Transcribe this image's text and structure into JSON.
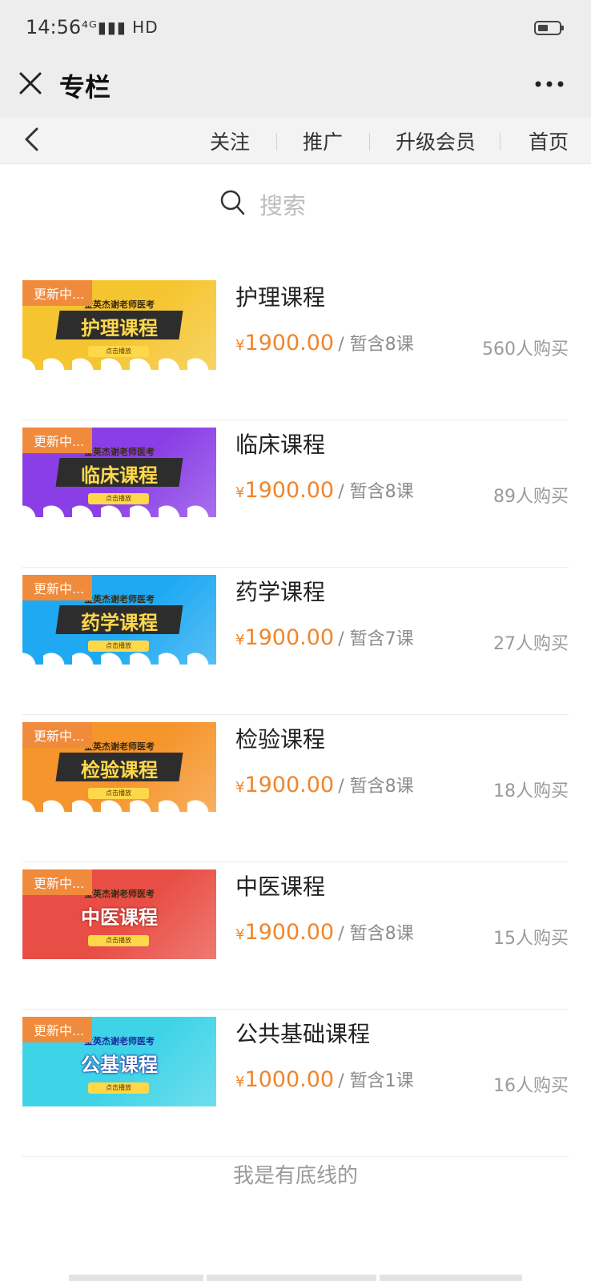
{
  "status_bar": {
    "time": "14:56",
    "network": "⁴ᴳ▮▮▮ HD"
  },
  "title_bar": {
    "title": "专栏"
  },
  "nav": {
    "items": [
      "关注",
      "推广",
      "升级会员",
      "首页"
    ]
  },
  "search": {
    "placeholder": "搜索"
  },
  "courses": [
    {
      "name": "护理课程",
      "thumb_title": "护理课程",
      "thumb_tag": "更新中...",
      "thumb_sub": "金英杰谢老师医考",
      "thumb_btn": "点击播放",
      "currency": "¥",
      "price": "1900.00",
      "lessons": "/ 暂含8课",
      "buyers": "560人购买",
      "color": "#f5c531"
    },
    {
      "name": "临床课程",
      "thumb_title": "临床课程",
      "thumb_tag": "更新中...",
      "thumb_sub": "金英杰谢老师医考",
      "thumb_btn": "点击播放",
      "currency": "¥",
      "price": "1900.00",
      "lessons": "/ 暂含8课",
      "buyers": "89人购买",
      "color": "#8a3fe6"
    },
    {
      "name": "药学课程",
      "thumb_title": "药学课程",
      "thumb_tag": "更新中...",
      "thumb_sub": "金英杰谢老师医考",
      "thumb_btn": "点击播放",
      "currency": "¥",
      "price": "1900.00",
      "lessons": "/ 暂含7课",
      "buyers": "27人购买",
      "color": "#1fa9f2"
    },
    {
      "name": "检验课程",
      "thumb_title": "检验课程",
      "thumb_tag": "更新中...",
      "thumb_sub": "金英杰谢老师医考",
      "thumb_btn": "点击播放",
      "currency": "¥",
      "price": "1900.00",
      "lessons": "/ 暂含8课",
      "buyers": "18人购买",
      "color": "#f5952b"
    },
    {
      "name": "中医课程",
      "thumb_title": "中医课程",
      "thumb_tag": "更新中...",
      "thumb_sub": "金英杰谢老师医考",
      "thumb_btn": "点击播放",
      "currency": "¥",
      "price": "1900.00",
      "lessons": "/ 暂含8课",
      "buyers": "15人购买",
      "color": "#e84e45"
    },
    {
      "name": "公共基础课程",
      "thumb_title": "公基课程",
      "thumb_tag": "更新中...",
      "thumb_sub": "金英杰谢老师医考",
      "thumb_btn": "点击播放",
      "currency": "¥",
      "price": "1000.00",
      "lessons": "/ 暂含1课",
      "buyers": "16人购买",
      "color": "#3fd3e8"
    }
  ],
  "footer": {
    "note": "我是有底线的"
  }
}
